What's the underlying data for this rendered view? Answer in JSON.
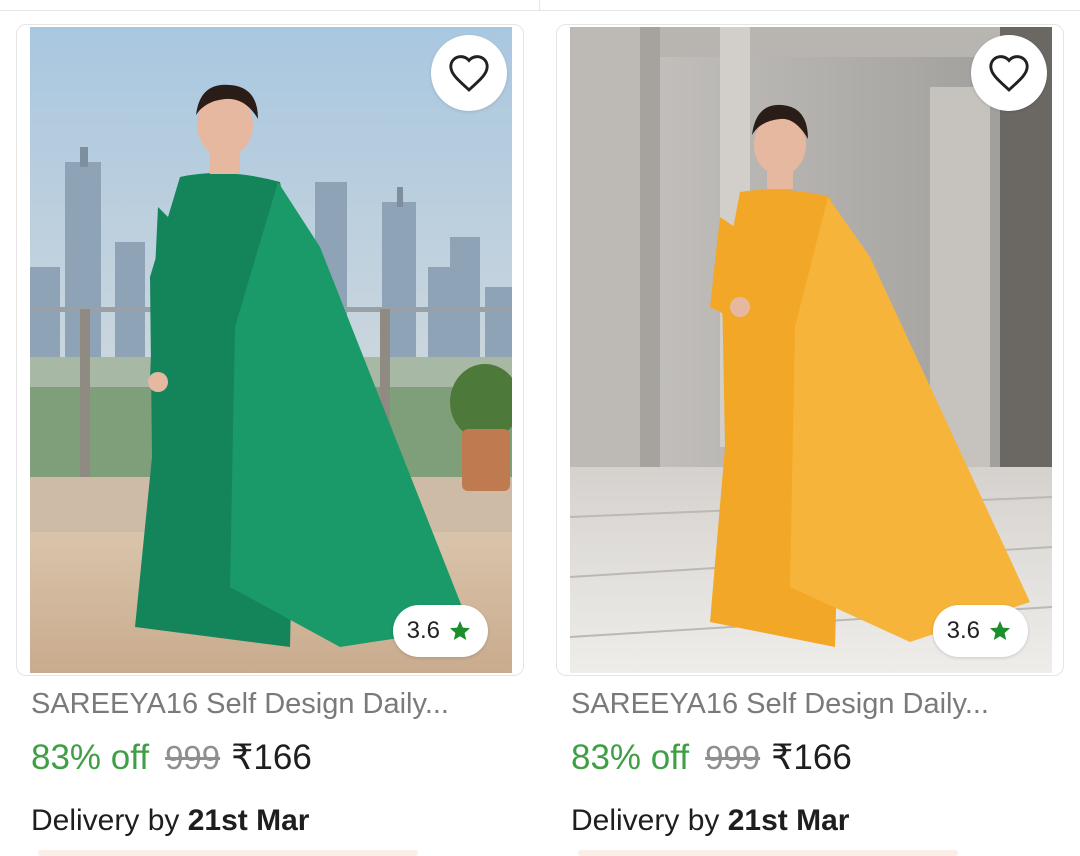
{
  "products": [
    {
      "name": "SAREEYA16 Self Design Daily...",
      "discount": "83% off",
      "mrp": "999",
      "price": "₹166",
      "rating": "3.6",
      "delivery_prefix": "Delivery by",
      "delivery_date": "21st Mar",
      "saree_color": "#14855a",
      "icons": {
        "wishlist": "heart-outline-icon",
        "rating": "star-icon"
      }
    },
    {
      "name": "SAREEYA16 Self Design Daily...",
      "discount": "83% off",
      "mrp": "999",
      "price": "₹166",
      "rating": "3.6",
      "delivery_prefix": "Delivery by",
      "delivery_date": "21st Mar",
      "saree_color": "#f3a726",
      "icons": {
        "wishlist": "heart-outline-icon",
        "rating": "star-icon"
      }
    }
  ],
  "colors": {
    "discount": "#3f9f45",
    "star": "#1a8f2b",
    "title": "#7a7a7a"
  }
}
